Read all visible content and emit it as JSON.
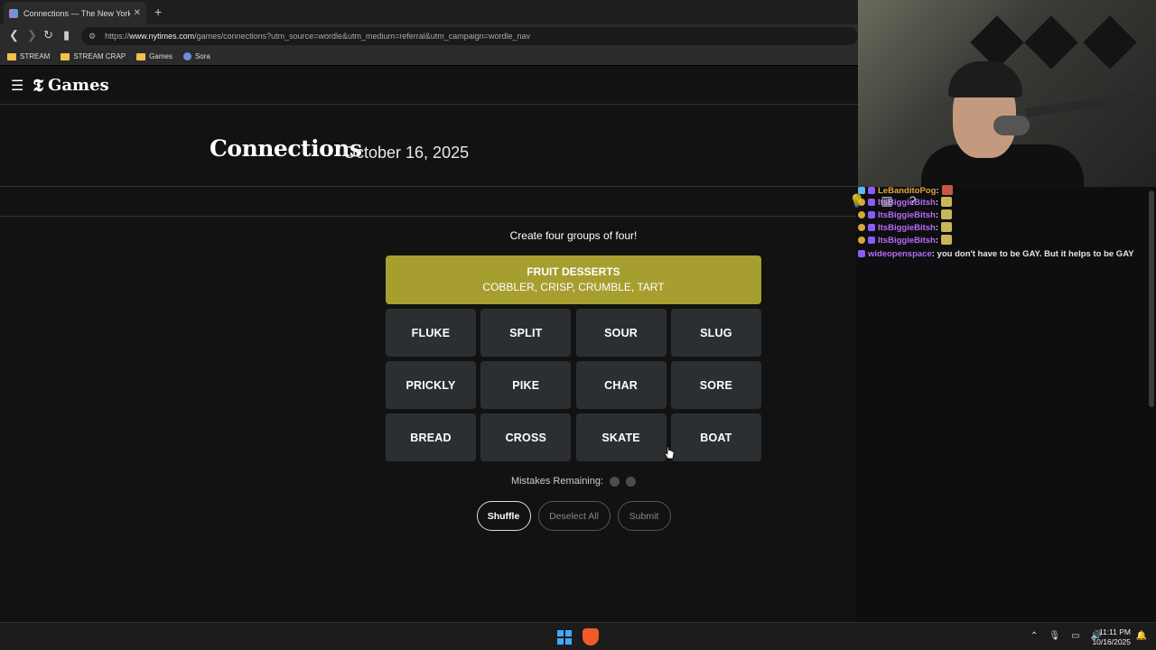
{
  "browser": {
    "tab_title": "Connections — The New York Ti",
    "tab_close": "✕",
    "new_tab": "+",
    "url_prefix": "https://",
    "url_domain": "www.nytimes.com",
    "url_path": "/games/connections?utm_source=wordle&utm_medium=referral&utm_campaign=wordle_nav",
    "bookmarks": [
      {
        "label": "STREAM",
        "icon": "folder-icon"
      },
      {
        "label": "STREAM CRAP",
        "icon": "folder-icon"
      },
      {
        "label": "Games",
        "icon": "folder-icon"
      },
      {
        "label": "Sora",
        "icon": "sora-icon"
      }
    ]
  },
  "header": {
    "brand_t": "𝕿",
    "brand_label": "Games"
  },
  "game": {
    "title": "Connections",
    "date": "October 16, 2025",
    "instruction": "Create four groups of four!",
    "solved": [
      {
        "category": "FRUIT DESSERTS",
        "words": "COBBLER, CRISP, CRUMBLE, TART",
        "color": "#a79e30"
      }
    ],
    "tiles": [
      "FLUKE",
      "SPLIT",
      "SOUR",
      "SLUG",
      "PRICKLY",
      "PIKE",
      "CHAR",
      "SORE",
      "BREAD",
      "CROSS",
      "SKATE",
      "BOAT"
    ],
    "mistakes_label": "Mistakes Remaining:",
    "mistakes_remaining": 2,
    "buttons": {
      "shuffle": "Shuffle",
      "deselect": "Deselect All",
      "submit": "Submit"
    }
  },
  "chat": {
    "messages": [
      {
        "user": "LeBanditoPog",
        "text": ":",
        "user_color": "#e6a338"
      },
      {
        "user": "ItsBiggieBitsh",
        "text": ":",
        "user_color": "#b56cf7"
      },
      {
        "user": "ItsBiggieBitsh",
        "text": ":",
        "user_color": "#b56cf7"
      },
      {
        "user": "ItsBiggieBitsh",
        "text": ":",
        "user_color": "#b56cf7"
      },
      {
        "user": "ItsBiggieBitsh",
        "text": ":",
        "user_color": "#b56cf7"
      },
      {
        "user": "wideopenspace",
        "text": ": you don't have to be GAY. But it helps to be GAY",
        "user_color": "#b56cf7"
      }
    ]
  },
  "taskbar": {
    "time": "11:11 PM",
    "date": "10/16/2025"
  }
}
